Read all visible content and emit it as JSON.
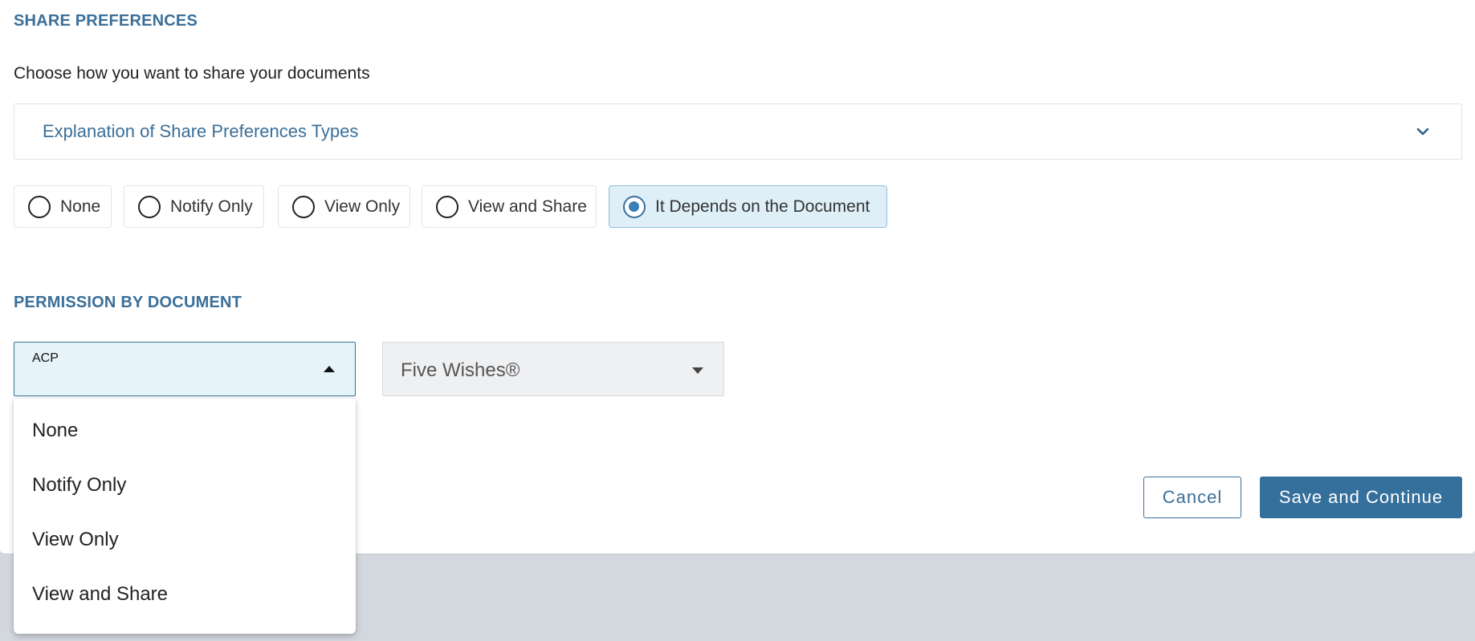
{
  "share_preferences": {
    "title": "SHARE PREFERENCES",
    "subtitle": "Choose how you want to share your documents",
    "accordion_label": "Explanation of Share Preferences Types",
    "options": [
      {
        "label": "None",
        "selected": false
      },
      {
        "label": "Notify Only",
        "selected": false
      },
      {
        "label": "View Only",
        "selected": false
      },
      {
        "label": "View and Share",
        "selected": false
      },
      {
        "label": "It Depends on the Document",
        "selected": true
      }
    ]
  },
  "permission_by_document": {
    "title": "PERMISSION BY DOCUMENT",
    "acp_select": {
      "label": "ACP",
      "value": "",
      "open": true,
      "options": [
        "None",
        "Notify Only",
        "View Only",
        "View and Share"
      ]
    },
    "five_wishes_select": {
      "value": "Five Wishes®"
    }
  },
  "actions": {
    "cancel_label": "Cancel",
    "save_label": "Save and Continue"
  },
  "colors": {
    "accent": "#3a6f99",
    "primary_button": "#356f9b",
    "selected_bg": "#deeff8",
    "page_bg": "#d3d7de"
  }
}
